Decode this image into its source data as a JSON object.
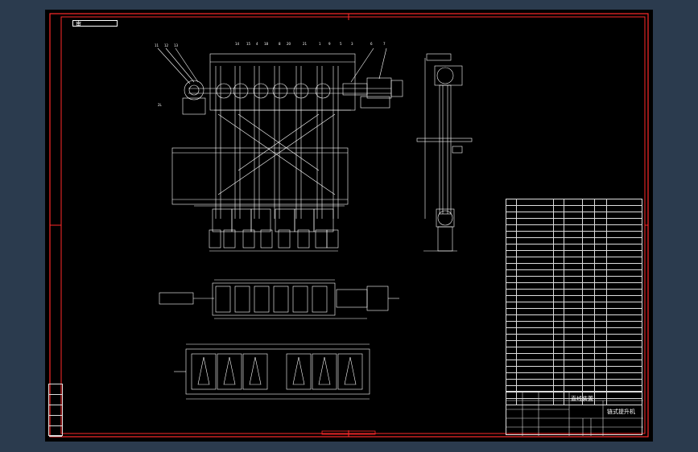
{
  "sheet": {
    "tag": "审",
    "title_block": {
      "name": "直线装置",
      "title": "链式提升机"
    }
  },
  "bom_rows": 32,
  "colors": {
    "frame": "#ff2a2a",
    "line": "#ffffff",
    "background": "#000000",
    "desktop": "#2b3b4e"
  }
}
